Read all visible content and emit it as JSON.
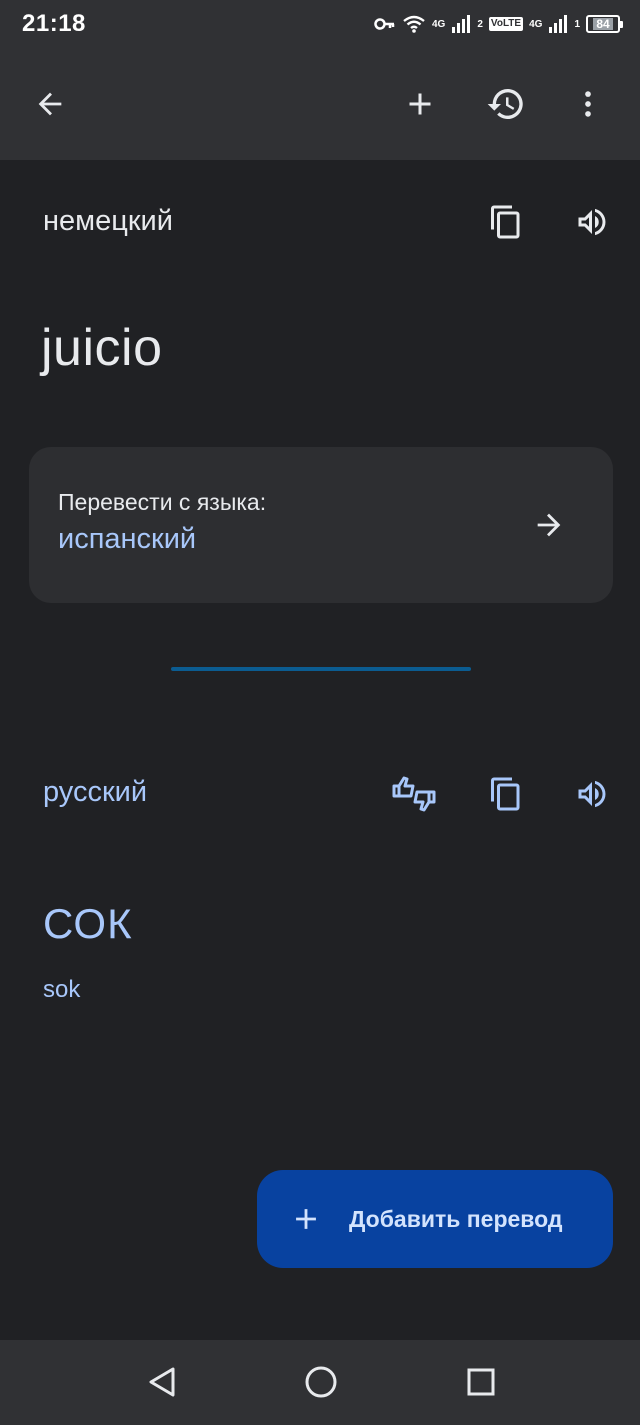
{
  "status_bar": {
    "time": "21:18",
    "net1": "4G",
    "sim1": "2",
    "volte": "VoLTE",
    "net2": "4G",
    "sim2": "1",
    "battery": "84"
  },
  "app_bar": {
    "icons": [
      "arrow-left-icon",
      "plus-icon",
      "history-icon",
      "more-vert-icon"
    ]
  },
  "source": {
    "language": "немецкий",
    "text": "juicio"
  },
  "from_card": {
    "label": "Перевести с языка:",
    "value": "испанский"
  },
  "target": {
    "language": "русский",
    "text": "СОК",
    "transliteration": "sok"
  },
  "fab": {
    "label": "Добавить перевод"
  },
  "colors": {
    "background": "#202124",
    "bar": "#303134",
    "card": "#2d2e31",
    "accent_text": "#a8c7fa",
    "fab": "#0842a0",
    "divider": "#0b5c91"
  }
}
